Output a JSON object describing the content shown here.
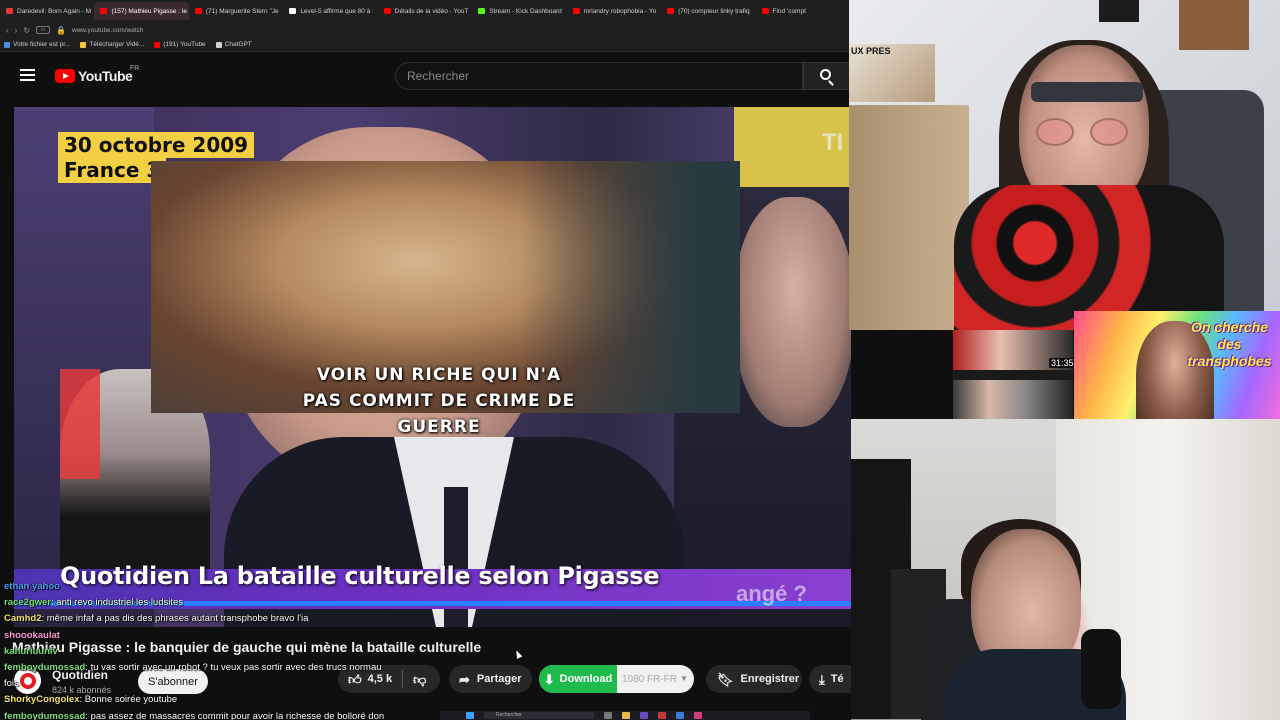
{
  "browser": {
    "tabs": [
      {
        "label": "Daredevil: Born Again - M",
        "color": "#e53935",
        "active": false
      },
      {
        "label": "(157) Mathieu Pigasse : le",
        "color": "#ff0000",
        "active": true
      },
      {
        "label": "(71) Marguerite Stern \"Je",
        "color": "#ff0000",
        "active": false
      },
      {
        "label": "Level-5 affirme que 80 à",
        "color": "#ffffff",
        "active": false
      },
      {
        "label": "Détails de la vidéo - YouT",
        "color": "#ff0000",
        "active": false
      },
      {
        "label": "Stream - Kick Dashboard",
        "color": "#53fc18",
        "active": false
      },
      {
        "label": "mrlandry robophobia - Yo",
        "color": "#ff0000",
        "active": false
      },
      {
        "label": "(70) compteur linky trafiq",
        "color": "#ff0000",
        "active": false
      },
      {
        "label": "Find 'compt",
        "color": "#ff0000",
        "active": false
      }
    ],
    "url": "www.youtube.com/watch",
    "bookmarks": [
      {
        "label": "Votre fichier est pr...",
        "color": "#4a90e2"
      },
      {
        "label": "Télécharger Vidé...",
        "color": "#f5c542"
      },
      {
        "label": "(191) YouTube",
        "color": "#ff0000"
      },
      {
        "label": "ChatGPT",
        "color": "#cfcfcf"
      }
    ]
  },
  "youtube": {
    "logo_text": "YouTube",
    "country": "FR",
    "search_placeholder": "Rechercher"
  },
  "video": {
    "date_label": "30 octobre 2009",
    "channel_label": "France 3",
    "corner_text": "TI",
    "overlay_caption_lines": [
      "VOIR UN RICHE QUI N'A",
      "PAS COMMIT DE CRIME DE",
      "GUERRE"
    ],
    "banner_text": "Quotidien La bataille culturelle selon Pigasse",
    "banner_question": "angé ?"
  },
  "below_video": {
    "title": "Mathieu Pigasse : le banquier de gauche qui mène la bataille culturelle",
    "channel_name": "Quotidien",
    "channel_subs": "824 k abonnés",
    "subscribe_label": "S'abonner",
    "like_count": "4,5 k",
    "share_label": "Partager",
    "download_label": "Download",
    "download_quality": "1080  FR-FR",
    "save_label": "Enregistrer",
    "more_label": "Té"
  },
  "chat": [
    {
      "user": "ethan yahoo",
      "message": "",
      "color": "#4fa3ff"
    },
    {
      "user": "race2gwer",
      "message": "anti revo industriel les ludsites",
      "color": "#7be07b"
    },
    {
      "user": "Camhd2",
      "message": "même infaf a pas dis des phrases autant transphobe bravo l'ia",
      "color": "#f5e56b"
    },
    {
      "user": "shoookaulat",
      "message": "",
      "color": "#ff9ad5"
    },
    {
      "user": "kahuriuuniv",
      "message": "",
      "color": "#7be07b"
    },
    {
      "user": "femboydumossad",
      "message": "tu vas sortir avec un robot ? tu veux pas sortir avec des trucs normau",
      "color": "#7be07b"
    },
    {
      "user": "",
      "message": "fois",
      "color": "#ffffff"
    },
    {
      "user": "ShorkyCongolex",
      "message": "Bonne soirée youtube",
      "color": "#f5e56b"
    },
    {
      "user": "femboydumossad",
      "message": "pas assez de massacres commit pour avoir la richesse de bolloré don",
      "color": "#7be07b"
    }
  ],
  "side": {
    "poster_text": "UX PRES",
    "thumb_time": "31:35",
    "rainbow_title": "On cherche des transphobes"
  },
  "taskbar": {
    "search_label": "Rechercher"
  }
}
